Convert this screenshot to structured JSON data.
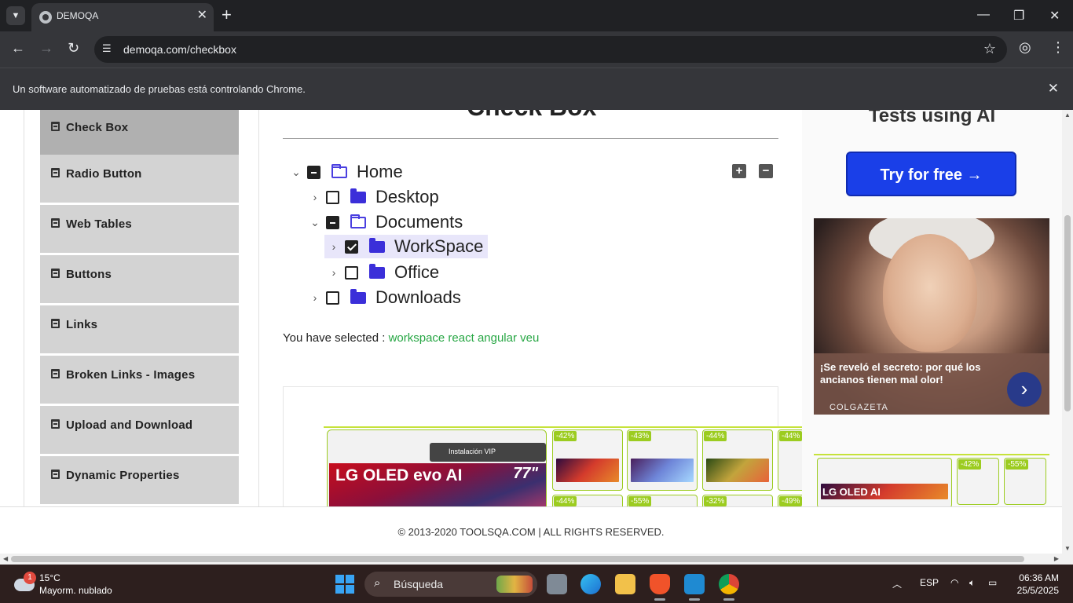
{
  "browser": {
    "tab_title": "DEMOQA",
    "url": "demoqa.com/checkbox",
    "infobar_message": "Un software automatizado de pruebas está controlando Chrome."
  },
  "sidebar": {
    "items": [
      {
        "label": "Check Box",
        "active": true
      },
      {
        "label": "Radio Button"
      },
      {
        "label": "Web Tables"
      },
      {
        "label": "Buttons"
      },
      {
        "label": "Links"
      },
      {
        "label": "Broken Links - Images"
      },
      {
        "label": "Upload and Download"
      },
      {
        "label": "Dynamic Properties"
      }
    ]
  },
  "main": {
    "heading": "Check Box",
    "tree": {
      "home": {
        "label": "Home",
        "state": "partial",
        "expanded": true
      },
      "desktop": {
        "label": "Desktop",
        "state": "unchecked",
        "expanded": false
      },
      "documents": {
        "label": "Documents",
        "state": "partial",
        "expanded": true
      },
      "workspace": {
        "label": "WorkSpace",
        "state": "checked",
        "expanded": false
      },
      "office": {
        "label": "Office",
        "state": "unchecked",
        "expanded": false
      },
      "downloads": {
        "label": "Downloads",
        "state": "unchecked",
        "expanded": false
      }
    },
    "expand_all_symbol": "+",
    "collapse_all_symbol": "−",
    "selected_prefix": "You have selected :",
    "selected_values": "workspace react angular veu"
  },
  "ads": {
    "right_heading": "Tests using AI",
    "try_button": "Try for free →",
    "article_caption": "¡Se reveló el secreto: por qué los ancianos tienen mal olor!",
    "article_source": "COLGAZETA",
    "big_tv_badge": "Instalación VIP",
    "big_tv_brand": "LG OLED evo AI",
    "big_tv_size": "77\"",
    "small_tv_brand": "LG OLED AI",
    "discounts_top": [
      "-42%",
      "-43%",
      "-44%",
      "-44%"
    ],
    "discounts_bottom": [
      "-44%",
      "-55%",
      "-32%",
      "-49%"
    ],
    "right_discounts": [
      "-42%",
      "-55%"
    ]
  },
  "footer": {
    "copyright": "© 2013-2020 TOOLSQA.COM | ALL RIGHTS RESERVED."
  },
  "taskbar": {
    "weather_temp": "15°C",
    "weather_desc": "Mayorm. nublado",
    "weather_badge": "1",
    "search_placeholder": "Búsqueda",
    "language": "ESP",
    "time": "06:36 AM",
    "date": "25/5/2025"
  },
  "colors": {
    "accent_green": "#28a745",
    "folder_blue": "#3b2fd9",
    "try_button": "#1a3fe8"
  }
}
